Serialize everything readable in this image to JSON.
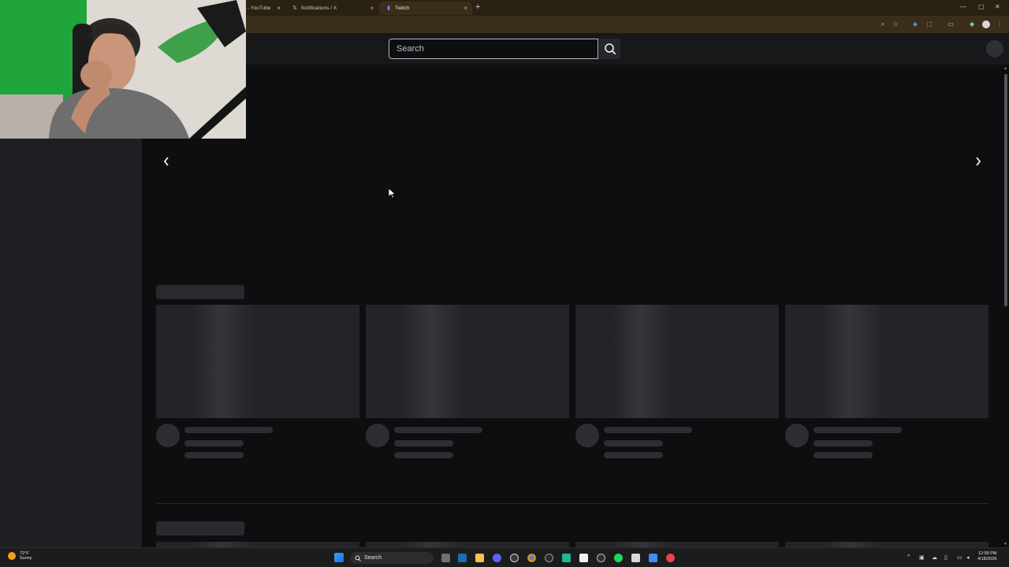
{
  "browser": {
    "tabs": [
      {
        "title": "- YouTube",
        "favicon": "youtube-icon",
        "active": false
      },
      {
        "title": "Notifications / X",
        "favicon": "x-logo-icon",
        "active": false
      },
      {
        "title": "Twitch",
        "favicon": "twitch-icon",
        "active": true
      }
    ],
    "new_tab_label": "+",
    "close_glyph": "×"
  },
  "twitch": {
    "search": {
      "placeholder": "Search",
      "value": ""
    },
    "colors": {
      "background": "#0e0e10",
      "sidebar": "#1f1f23",
      "topnav": "#18181b",
      "skeleton": "#2a2a2e"
    }
  },
  "taskbar": {
    "weather": {
      "temp": "72°F",
      "condition": "Sunny"
    },
    "search_label": "Search",
    "clock": {
      "time": "12:59 PM",
      "date": "4/18/2026"
    }
  }
}
